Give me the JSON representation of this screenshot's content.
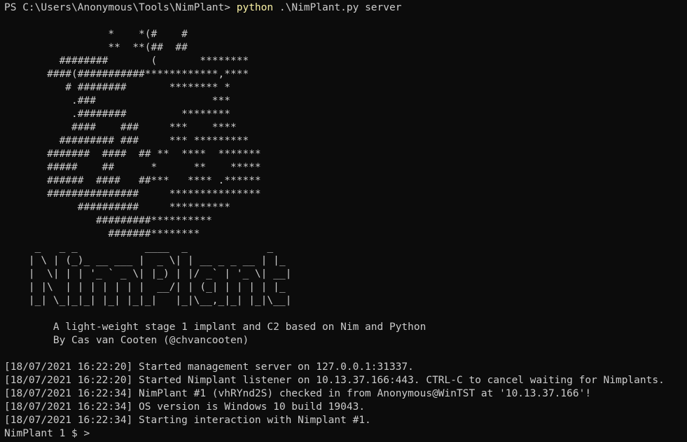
{
  "prompt": {
    "path": "PS C:\\Users\\Anonymous\\Tools\\NimPlant> ",
    "command": "python",
    "args": " .\\NimPlant.py server"
  },
  "banner": {
    "art": [
      "                 *    *(#    #",
      "                 **  **(##  ##",
      "         ########       (       ********",
      "       ####(###########************,****",
      "          # ########       ******** *",
      "           .###                   ***",
      "           .########         ********",
      "           ####    ###     ***    ****",
      "         ######### ###     *** *********",
      "       #######  ####  ## **  ****  *******",
      "       #####    ##      *      **    *****",
      "       ######  ####   ##***   **** .******",
      "       ###############     ***************",
      "            ##########     **********",
      "               #########**********",
      "                 #######********"
    ],
    "logo": [
      "     _   _ _           ____  _             _",
      "    | \\ | (_)_ __ ___ |  _ \\| | __ _ _ __ | |_",
      "    |  \\| | | '_ ` _ \\| |_) | |/ _` | '_ \\| __|",
      "    | |\\  | | | | | | |  __/| | (_| | | | | |_",
      "    |_| \\_|_|_| |_| |_|_|   |_|\\__,_|_| |_|\\__|"
    ],
    "tagline": "        A light-weight stage 1 implant and C2 based on Nim and Python",
    "author": "        By Cas van Cooten (@chvancooten)"
  },
  "log": [
    "[18/07/2021 16:22:20] Started management server on 127.0.0.1:31337.",
    "[18/07/2021 16:22:20] Started Nimplant listener on 10.13.37.166:443. CTRL-C to cancel waiting for Nimplants.",
    "[18/07/2021 16:22:34] NimPlant #1 (vhRYnd2S) checked in from Anonymous@WinTST at '10.13.37.166'!",
    "[18/07/2021 16:22:34] OS version is Windows 10 build 19043.",
    "[18/07/2021 16:22:34] Starting interaction with Nimplant #1."
  ],
  "shell_prompt": "NimPlant 1 $ > "
}
